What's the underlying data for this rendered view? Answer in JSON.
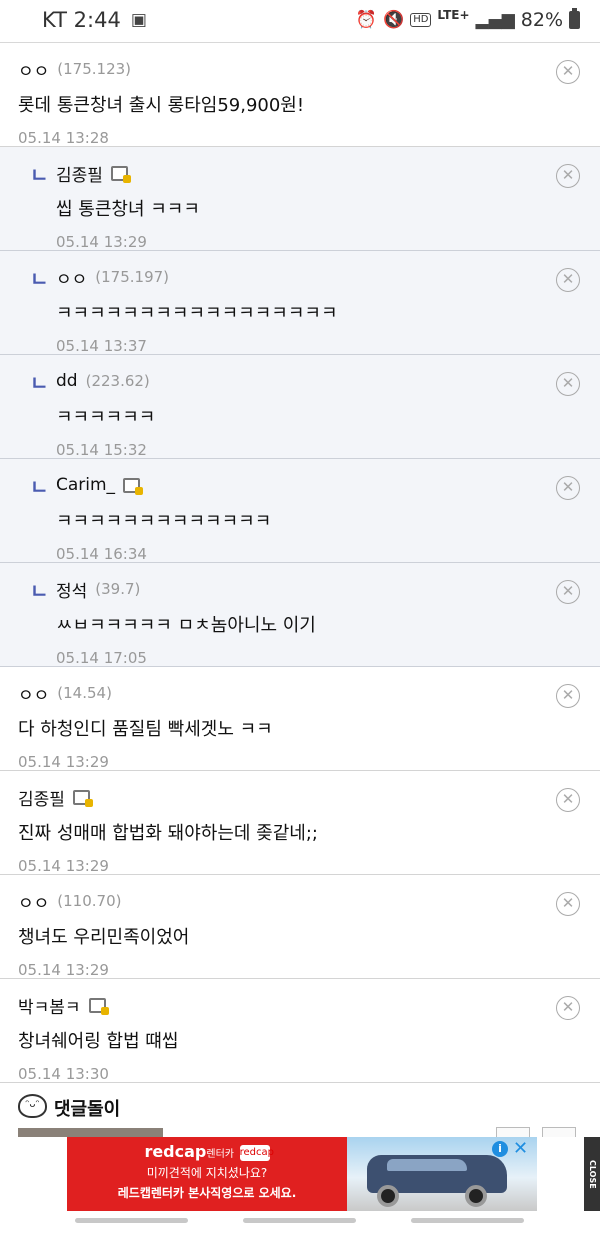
{
  "status_bar": {
    "carrier_time": "KT 2:44",
    "lte": "LTE+",
    "hd": "HD",
    "battery": "82%",
    "icons": [
      "gallery-icon",
      "alarm-icon",
      "mute-icon",
      "signal-icon",
      "battery-icon"
    ]
  },
  "comments": [
    {
      "name": "ㅇㅇ",
      "ip": "(175.123)",
      "text": "롯데 통큰창녀 출시 롱타임59,900원!",
      "time": "05.14 13:28",
      "reply": false,
      "member": false
    },
    {
      "name": "김종필",
      "ip": "",
      "text": "씹 통큰창녀 ㅋㅋㅋ",
      "time": "05.14 13:29",
      "reply": true,
      "member": true
    },
    {
      "name": "ㅇㅇ",
      "ip": "(175.197)",
      "text": "ㅋㅋㅋㅋㅋㅋㅋㅋㅋㅋㅋㅋㅋㅋㅋㅋㅋ",
      "time": "05.14 13:37",
      "reply": true,
      "member": false
    },
    {
      "name": "dd",
      "ip": "(223.62)",
      "text": "ㅋㅋㅋㅋㅋㅋ",
      "time": "05.14 15:32",
      "reply": true,
      "member": false
    },
    {
      "name": "Carim_",
      "ip": "",
      "text": "ㅋㅋㅋㅋㅋㅋㅋㅋㅋㅋㅋㅋㅋ",
      "time": "05.14 16:34",
      "reply": true,
      "member": true
    },
    {
      "name": "정석",
      "ip": "(39.7)",
      "text": "ㅆㅂㅋㅋㅋㅋㅋ ㅁㅊ놈아니노 이기",
      "time": "05.14 17:05",
      "reply": true,
      "member": false
    },
    {
      "name": "ㅇㅇ",
      "ip": "(14.54)",
      "text": "다 하청인디 품질팀 빡세겟노 ㅋㅋ",
      "time": "05.14 13:29",
      "reply": false,
      "member": false
    },
    {
      "name": "김종필",
      "ip": "",
      "text": "진짜 성매매 합법화 돼야하는데 좆같네;;",
      "time": "05.14 13:29",
      "reply": false,
      "member": true
    },
    {
      "name": "ㅇㅇ",
      "ip": "(110.70)",
      "text": "챙녀도 우리민족이었어",
      "time": "05.14 13:29",
      "reply": false,
      "member": false
    },
    {
      "name": "박ㅋ봄ㅋ",
      "ip": "",
      "text": "창녀쉐어링 합법 떄씹",
      "time": "05.14 13:30",
      "reply": false,
      "member": true
    }
  ],
  "reply_mark": "ㄴ",
  "delete_glyph": "✕",
  "comment_bot": {
    "title": "댓글돌이"
  },
  "ad": {
    "brand": "redcap",
    "brand_sub": "렌터카",
    "logo_text": "redcap",
    "line1": "미끼견적에 지치셨나요?",
    "line2": "레드캡렌터카 본사직영으로 오세요.",
    "info": "i",
    "close_x": "✕",
    "close_label": "CLOSE"
  }
}
